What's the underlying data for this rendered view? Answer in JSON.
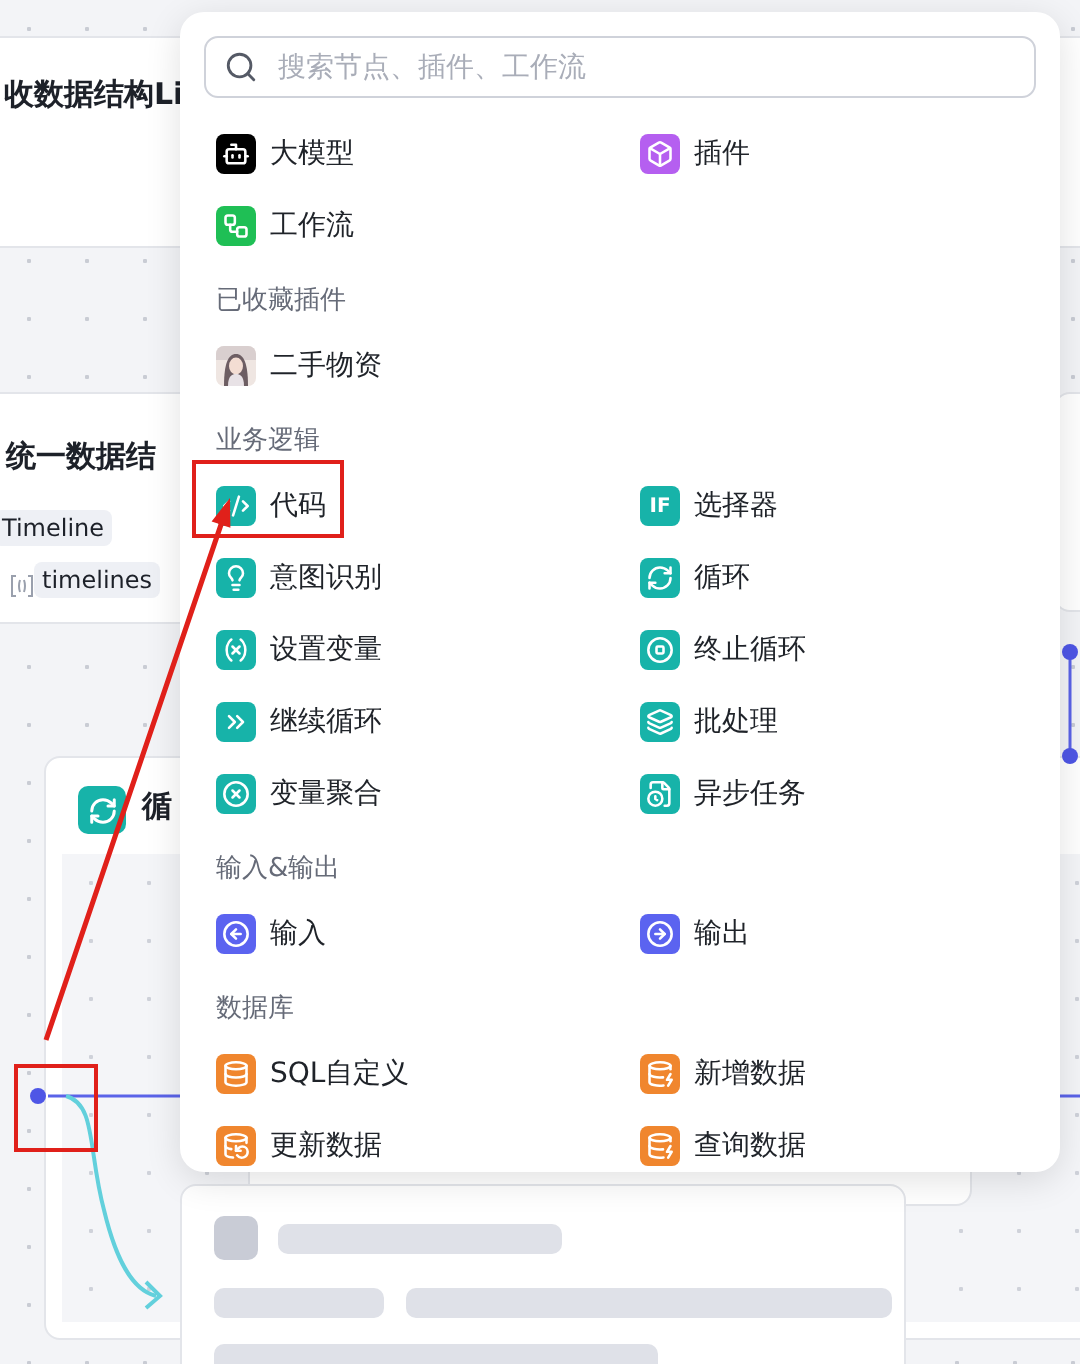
{
  "canvas": {
    "nodes": [
      {
        "kind": "header_card",
        "title": "收数据结构Li"
      },
      {
        "kind": "data_card",
        "title": "统一数据结",
        "tag": "Timeline",
        "field": "timelines"
      },
      {
        "kind": "side_card"
      },
      {
        "kind": "loop",
        "title": "循"
      },
      {
        "kind": "skeleton"
      }
    ]
  },
  "node_menu": {
    "search": {
      "placeholder": "搜索节点、插件、工作流"
    },
    "groups": [
      {
        "items": [
          {
            "label": "大模型",
            "kind": "icon",
            "color": "#000000"
          },
          {
            "label": "插件",
            "kind": "icon",
            "color": "#b55ff0"
          },
          {
            "label": "工作流",
            "kind": "icon",
            "color": "#1fbf55"
          }
        ]
      },
      {
        "title": "已收藏插件",
        "items": [
          {
            "label": "二手物资",
            "kind": "avatar"
          }
        ]
      },
      {
        "title": "业务逻辑",
        "items": [
          {
            "label": "代码",
            "kind": "icon",
            "color": "#17b3a9"
          },
          {
            "label": "选择器",
            "kind": "text_icon",
            "icon_text": "IF",
            "color": "#17b3a9"
          },
          {
            "label": "意图识别",
            "kind": "icon",
            "color": "#17b3a9"
          },
          {
            "label": "循环",
            "kind": "icon",
            "color": "#17b3a9"
          },
          {
            "label": "设置变量",
            "kind": "icon",
            "color": "#17b3a9"
          },
          {
            "label": "终止循环",
            "kind": "icon",
            "color": "#17b3a9"
          },
          {
            "label": "继续循环",
            "kind": "icon",
            "color": "#17b3a9"
          },
          {
            "label": "批处理",
            "kind": "icon",
            "color": "#17b3a9"
          },
          {
            "label": "变量聚合",
            "kind": "icon",
            "color": "#17b3a9"
          },
          {
            "label": "异步任务",
            "kind": "icon",
            "color": "#17b3a9"
          }
        ]
      },
      {
        "title": "输入&输出",
        "items": [
          {
            "label": "输入",
            "kind": "icon",
            "color": "#5b63f0"
          },
          {
            "label": "输出",
            "kind": "icon",
            "color": "#5b63f0"
          }
        ]
      },
      {
        "title": "数据库",
        "items": [
          {
            "label": "SQL自定义",
            "kind": "icon",
            "color": "#f0862e"
          },
          {
            "label": "新增数据",
            "kind": "icon",
            "color": "#f0862e"
          },
          {
            "label": "更新数据",
            "kind": "icon",
            "color": "#f0862e"
          },
          {
            "label": "查询数据",
            "kind": "icon",
            "color": "#f0862e"
          }
        ]
      }
    ]
  }
}
